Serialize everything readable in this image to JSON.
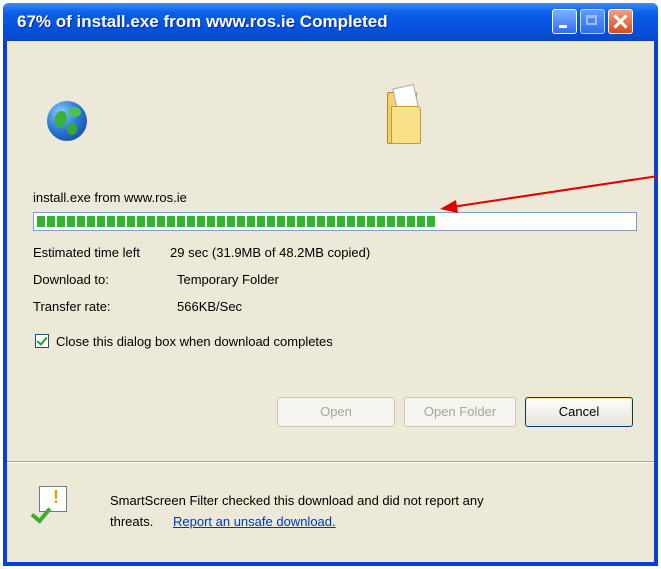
{
  "window": {
    "title": "67% of install.exe from www.ros.ie Completed"
  },
  "download": {
    "source_label": "install.exe from www.ros.ie",
    "progress_fraction": 0.67,
    "estimated_time_label": "Estimated time left",
    "estimated_time_value": "29 sec (31.9MB of 48.2MB copied)",
    "download_to_label": "Download to:",
    "download_to_value": "Temporary Folder",
    "transfer_rate_label": "Transfer rate:",
    "transfer_rate_value": "566KB/Sec"
  },
  "options": {
    "close_on_complete_label": "Close this dialog box when download completes",
    "close_on_complete_checked": true
  },
  "buttons": {
    "open": "Open",
    "open_folder": "Open Folder",
    "cancel": "Cancel"
  },
  "smartscreen": {
    "message": "SmartScreen Filter checked this download and did not report any",
    "message_line2": "threats.",
    "report_link": "Report an unsafe download."
  },
  "colors": {
    "progress_fill": "#2fb52f",
    "annotation_arrow": "#e00000",
    "titlebar": "#0550dc"
  },
  "icons": {
    "globe": "globe-icon",
    "folder": "folder-icon",
    "smartscreen": "smartscreen-shield-icon"
  }
}
